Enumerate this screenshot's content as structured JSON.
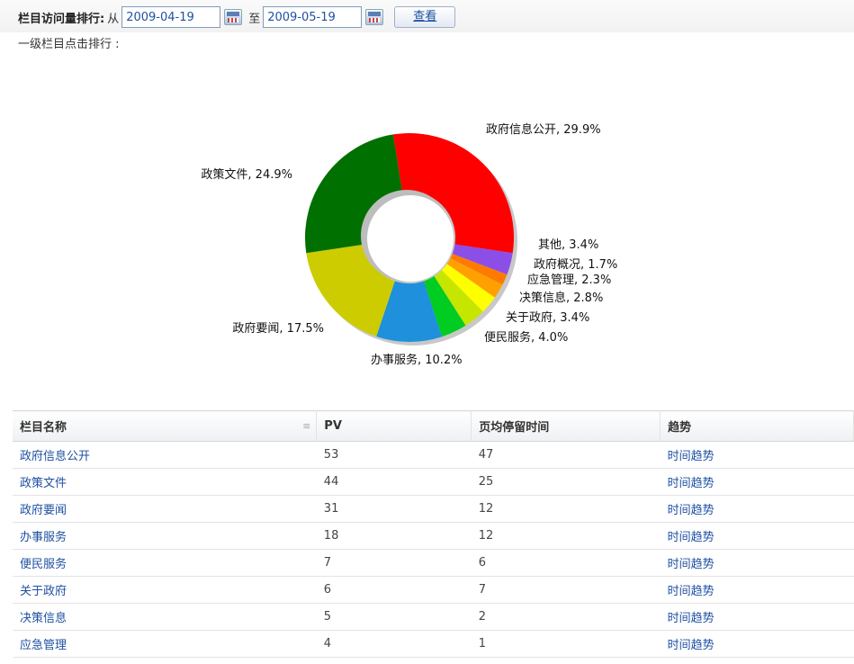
{
  "toolbar": {
    "title": "栏目访问量排行:",
    "from_label": "从",
    "start_date": "2009-04-19",
    "to_label": "至",
    "end_date": "2009-05-19",
    "view_button": "查看"
  },
  "subtitle": "一级栏目点击排行 :",
  "chart_data": {
    "type": "pie",
    "categories": [
      "政府信息公开",
      "其他",
      "政府概况",
      "应急管理",
      "决策信息",
      "关于政府",
      "便民服务",
      "办事服务",
      "政府要闻",
      "政策文件"
    ],
    "values": [
      29.9,
      3.4,
      1.7,
      2.3,
      2.8,
      3.4,
      4.0,
      10.2,
      17.5,
      24.9
    ],
    "labels": [
      "政府信息公开, 29.9%",
      "其他, 3.4%",
      "政府概况, 1.7%",
      "应急管理, 2.3%",
      "决策信息, 2.8%",
      "关于政府, 3.4%",
      "便民服务, 4.0%",
      "办事服务, 10.2%",
      "政府要闻, 17.5%",
      "政策文件, 24.9%"
    ],
    "colors": [
      "#ff0000",
      "#8b4fe8",
      "#ff7a00",
      "#ff9c00",
      "#ffe000",
      "#f2ff30",
      "#a8e000",
      "#00cc22",
      "#1e90dc",
      "#cccc00",
      "#007000"
    ],
    "slice_colors": [
      "#ff0000",
      "#8b4fe8",
      "#ff7a00",
      "#ffa000",
      "#ffff00",
      "#c6e600",
      "#00cc22",
      "#1e90dc",
      "#cccc00",
      "#007000"
    ]
  },
  "table": {
    "headers": [
      "栏目名称",
      "PV",
      "页均停留时间",
      "趋势"
    ],
    "rows": [
      [
        "政府信息公开",
        "53",
        "47",
        "时间趋势"
      ],
      [
        "政策文件",
        "44",
        "25",
        "时间趋势"
      ],
      [
        "政府要闻",
        "31",
        "12",
        "时间趋势"
      ],
      [
        "办事服务",
        "18",
        "12",
        "时间趋势"
      ],
      [
        "便民服务",
        "7",
        "6",
        "时间趋势"
      ],
      [
        "关于政府",
        "6",
        "7",
        "时间趋势"
      ],
      [
        "决策信息",
        "5",
        "2",
        "时间趋势"
      ],
      [
        "应急管理",
        "4",
        "1",
        "时间趋势"
      ]
    ],
    "menu_icon": "≡"
  }
}
